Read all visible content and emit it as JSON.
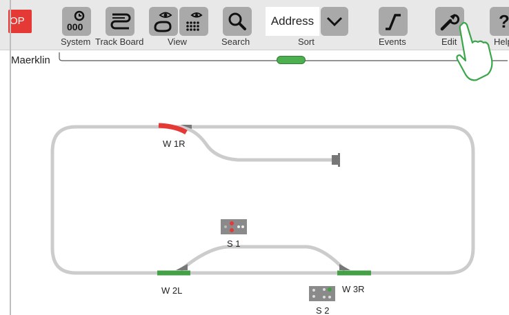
{
  "toolbar": {
    "stop_label": "OP",
    "buttons": [
      {
        "name": "system",
        "label": "System",
        "icon": "clock-counter-icon"
      },
      {
        "name": "track-board",
        "label": "Track Board",
        "icon": "track-board-icon"
      },
      {
        "name": "view",
        "label": "View",
        "icon": "eye-track-icon"
      },
      {
        "name": "search",
        "label": "Search",
        "icon": "search-icon"
      },
      {
        "name": "events",
        "label": "Events",
        "icon": "events-icon"
      },
      {
        "name": "edit",
        "label": "Edit",
        "icon": "wrench-icon"
      },
      {
        "name": "help",
        "label": "Help",
        "icon": "question-icon"
      }
    ],
    "sort": {
      "value": "Address",
      "label": "Sort"
    }
  },
  "board": {
    "tab_label": "Maerklin"
  },
  "track": {
    "switches": [
      {
        "label": "W 1R",
        "state": "red"
      },
      {
        "label": "W 2L",
        "state": "green"
      },
      {
        "label": "W 3R",
        "state": "green"
      }
    ],
    "signals": [
      {
        "label": "S 1",
        "state": "red"
      },
      {
        "label": "S 2",
        "state": "green"
      }
    ]
  },
  "colors": {
    "toolbar_bg": "#e8e8e8",
    "button_bg": "#a9a9a9",
    "track": "#cccccc",
    "switch_red": "#e53935",
    "switch_green": "#43a047",
    "stop": "#e53935",
    "hand_outline": "#3aa64a"
  }
}
